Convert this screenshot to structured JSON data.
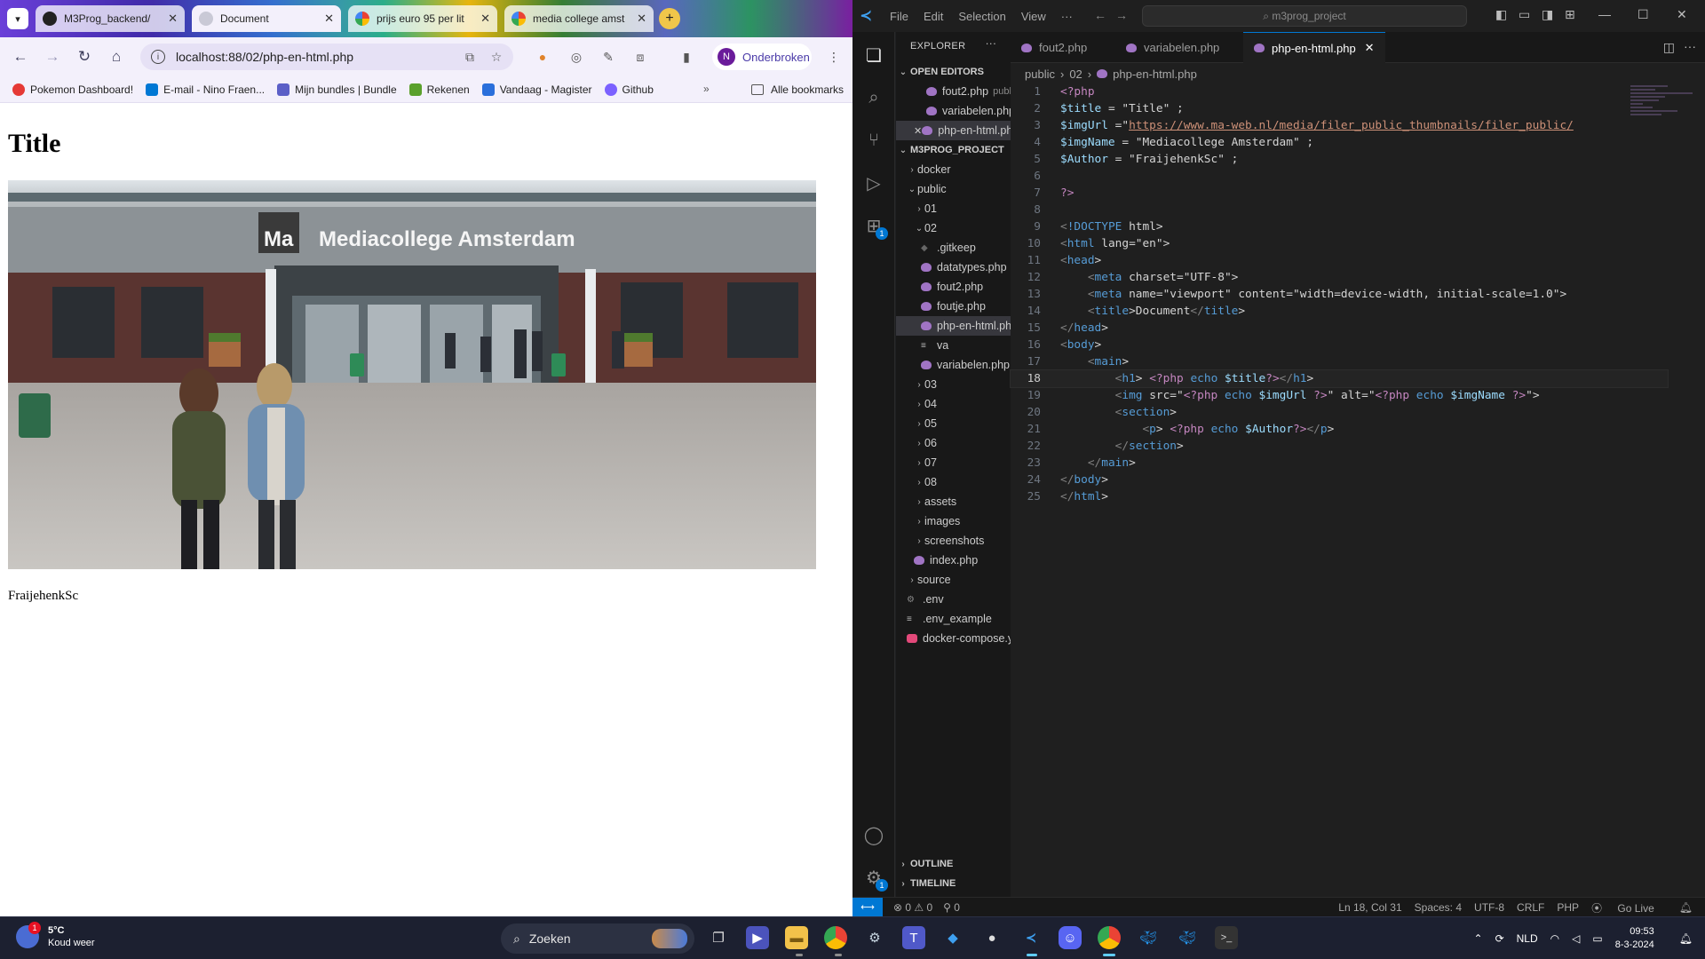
{
  "browser": {
    "tabs": [
      {
        "title": "M3Prog_backend/",
        "icon": "github-icon"
      },
      {
        "title": "Document",
        "icon": "document-icon"
      },
      {
        "title": "prijs euro 95 per lit",
        "icon": "google-icon"
      },
      {
        "title": "media college amst",
        "icon": "google-icon"
      }
    ],
    "url": "localhost:88/02/php-en-html.php",
    "profile_initial": "N",
    "profile_label": "Onderbroken",
    "bookmarks": [
      {
        "label": "Pokemon Dashboard!",
        "color": "#e53935"
      },
      {
        "label": "E-mail - Nino Fraen...",
        "color": "#0078d4"
      },
      {
        "label": "Mijn bundles | Bundle",
        "color": "#5b5fc7"
      },
      {
        "label": "Rekenen",
        "color": "#5aa02c"
      },
      {
        "label": "Vandaag - Magister",
        "color": "#2a6fdb"
      },
      {
        "label": "Github",
        "color": "#7b61ff"
      }
    ],
    "bookmarks_more": "»",
    "all_bookmarks": "Alle bookmarks",
    "page": {
      "heading": "Title",
      "image_alt": "Mediacollege Amsterdam",
      "sign_text": "Ma Mediacollege Amsterdam",
      "author": "FraijehenkSc"
    }
  },
  "vscode": {
    "menu": [
      "File",
      "Edit",
      "Selection",
      "View",
      "···"
    ],
    "search": "m3prog_project",
    "explorer_title": "EXPLORER",
    "open_editors_title": "OPEN EDITORS",
    "open_editors": [
      {
        "name": "fout2.php",
        "hint": "public..."
      },
      {
        "name": "variabelen.php...",
        "hint": ""
      },
      {
        "name": "php-en-html.ph...",
        "hint": ""
      }
    ],
    "project_title": "M3PROG_PROJECT",
    "tree": [
      {
        "name": "docker",
        "indent": 1,
        "kind": "folder",
        "open": false
      },
      {
        "name": "public",
        "indent": 1,
        "kind": "folder",
        "open": true
      },
      {
        "name": "01",
        "indent": 2,
        "kind": "folder",
        "open": false
      },
      {
        "name": "02",
        "indent": 2,
        "kind": "folder",
        "open": true
      },
      {
        "name": ".gitkeep",
        "indent": 3,
        "kind": "git"
      },
      {
        "name": "datatypes.php",
        "indent": 3,
        "kind": "php"
      },
      {
        "name": "fout2.php",
        "indent": 3,
        "kind": "php"
      },
      {
        "name": "foutje.php",
        "indent": 3,
        "kind": "php"
      },
      {
        "name": "php-en-html.php",
        "indent": 3,
        "kind": "php",
        "selected": true
      },
      {
        "name": "va",
        "indent": 3,
        "kind": "text"
      },
      {
        "name": "variabelen.php",
        "indent": 3,
        "kind": "php"
      },
      {
        "name": "03",
        "indent": 2,
        "kind": "folder",
        "open": false
      },
      {
        "name": "04",
        "indent": 2,
        "kind": "folder",
        "open": false
      },
      {
        "name": "05",
        "indent": 2,
        "kind": "folder",
        "open": false
      },
      {
        "name": "06",
        "indent": 2,
        "kind": "folder",
        "open": false
      },
      {
        "name": "07",
        "indent": 2,
        "kind": "folder",
        "open": false
      },
      {
        "name": "08",
        "indent": 2,
        "kind": "folder",
        "open": false
      },
      {
        "name": "assets",
        "indent": 2,
        "kind": "folder",
        "open": false
      },
      {
        "name": "images",
        "indent": 2,
        "kind": "folder",
        "open": false
      },
      {
        "name": "screenshots",
        "indent": 2,
        "kind": "folder",
        "open": false
      },
      {
        "name": "index.php",
        "indent": 2,
        "kind": "php"
      },
      {
        "name": "source",
        "indent": 1,
        "kind": "folder",
        "open": false
      },
      {
        "name": ".env",
        "indent": 1,
        "kind": "gear"
      },
      {
        "name": ".env_example",
        "indent": 1,
        "kind": "text"
      },
      {
        "name": "docker-compose.yml",
        "indent": 1,
        "kind": "docker"
      }
    ],
    "outline_title": "OUTLINE",
    "timeline_title": "TIMELINE",
    "editor_tabs": [
      "fout2.php",
      "variabelen.php",
      "php-en-html.php"
    ],
    "breadcrumb": [
      "public",
      "02",
      "php-en-html.php"
    ],
    "code_lines": [
      "<?php",
      "$title = \"Title\" ;",
      "$imgUrl =\"https://www.ma-web.nl/media/filer_public_thumbnails/filer_public/",
      "$imgName = \"Mediacollege Amsterdam\" ;",
      "$Author = \"FraijehenkSc\" ;",
      "",
      "?>",
      "",
      "<!DOCTYPE html>",
      "<html lang=\"en\">",
      "<head>",
      "    <meta charset=\"UTF-8\">",
      "    <meta name=\"viewport\" content=\"width=device-width, initial-scale=1.0\">",
      "    <title>Document</title>",
      "</head>",
      "<body>",
      "    <main>",
      "        <h1> <?php echo $title?></h1>",
      "        <img src=\"<?php echo $imgUrl ?>\" alt=\"<?php echo $imgName ?>\">",
      "        <section>",
      "            <p> <?php echo $Author?></p>",
      "        </section>",
      "    </main>",
      "</body>",
      "</html>"
    ],
    "current_line": 18,
    "status": {
      "errors": "⊗ 0 ⚠ 0",
      "ports": "⚲ 0",
      "position": "Ln 18, Col 31",
      "spaces": "Spaces: 4",
      "encoding": "UTF-8",
      "eol": "CRLF",
      "language": "PHP",
      "golive": "Go Live"
    }
  },
  "taskbar": {
    "temperature": "5°C",
    "weather": "Koud weer",
    "weather_badge": "1",
    "search": "Zoeken",
    "language": "NLD",
    "time": "09:53",
    "date": "8-3-2024"
  },
  "colors": {
    "vscode_accent": "#0078d4",
    "php_icon": "#a074c4",
    "profile": "#6a1b9a"
  }
}
